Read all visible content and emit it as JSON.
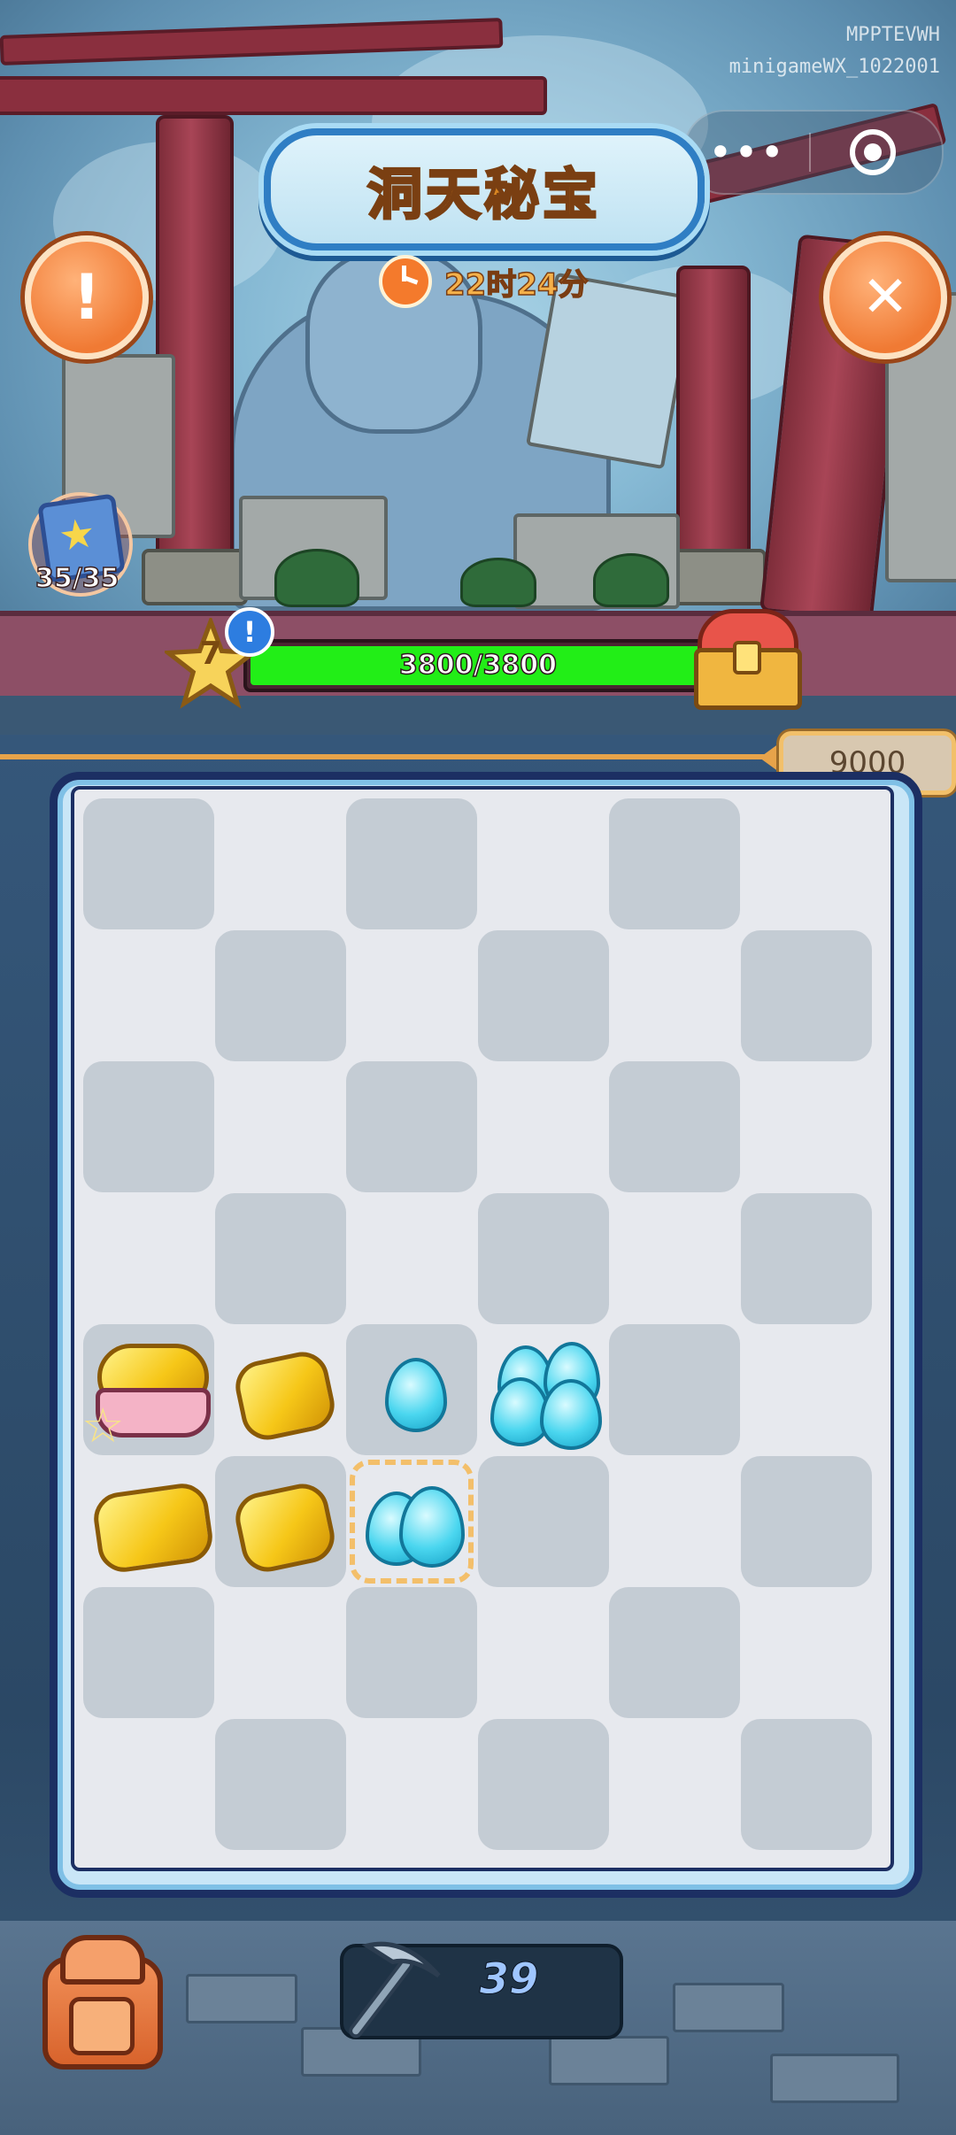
{
  "header": {
    "title": "洞天秘宝",
    "timer": "22时24分",
    "watermark_line1": "MPPTEVWH",
    "watermark_line2": "minigameWX_1022001"
  },
  "menu_capsule": {
    "more_label": "•••"
  },
  "collection": {
    "count": "35/35"
  },
  "level": {
    "number": "7",
    "progress_text": "3800/3800",
    "progress_fraction": 1.0
  },
  "score": {
    "value": "9000"
  },
  "pickaxe": {
    "count": "39"
  },
  "board": {
    "columns": 6,
    "rows": 8,
    "items": [
      {
        "row": 4,
        "col": 0,
        "kind": "gold-basket"
      },
      {
        "row": 4,
        "col": 1,
        "kind": "gold-chunk"
      },
      {
        "row": 4,
        "col": 2,
        "kind": "blue-flame-small"
      },
      {
        "row": 4,
        "col": 3,
        "kind": "blue-flame-cluster"
      },
      {
        "row": 5,
        "col": 0,
        "kind": "gold-chunk-large"
      },
      {
        "row": 5,
        "col": 1,
        "kind": "gold-chunk"
      },
      {
        "row": 5,
        "col": 2,
        "kind": "blue-flame-medium",
        "selected": true
      }
    ]
  },
  "colors": {
    "progress_fill": "#22ee17",
    "title_text": "#d98622",
    "action_button": "#f07a34",
    "board_frame": "#1c2f63"
  }
}
